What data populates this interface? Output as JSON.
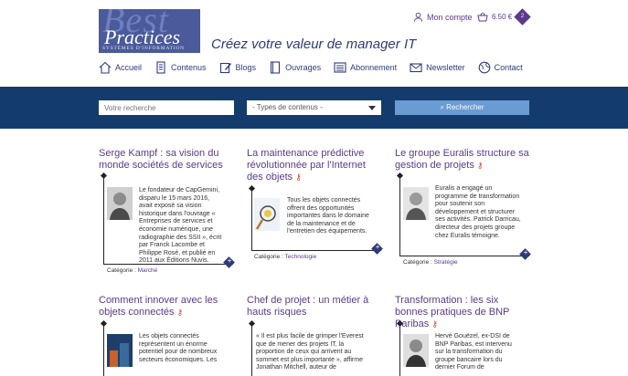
{
  "header": {
    "logo_big": "Best",
    "logo_practices": "Practices",
    "logo_sub": "SYSTÈMES D'INFORMATION",
    "tagline": "Créez votre valeur de manager IT",
    "account_label": "Mon compte",
    "cart_amount": "6.50 €",
    "cart_count": "2"
  },
  "nav": {
    "items": [
      {
        "label": "Accueil",
        "icon": "home-icon"
      },
      {
        "label": "Contenus",
        "icon": "document-icon"
      },
      {
        "label": "Blogs",
        "icon": "edit-icon"
      },
      {
        "label": "Ouvrages",
        "icon": "book-icon"
      },
      {
        "label": "Abonnement",
        "icon": "newspaper-icon"
      },
      {
        "label": "Newsletter",
        "icon": "envelope-icon"
      },
      {
        "label": "Contact",
        "icon": "globe-icon"
      }
    ]
  },
  "search": {
    "placeholder": "Votre recherche",
    "type_select": "- Types de contenus -",
    "button_label": "Rechercher"
  },
  "articles": [
    {
      "title": "Serge Kampf : sa vision du monde sociétés de services",
      "excerpt": "Le fondateur de CapGemini, disparu le 15 mars 2016, avait exposé sa vision historique dans l'ouvrage « Entreprises de services et économie numérique, une radiographie des SSII », écrit par Franck Lacombe et Philippe Rosé, et publié en 2011 aux Éditions Nuvis.",
      "category_label": "Catégorie :",
      "category": "Marché"
    },
    {
      "title": "La maintenance prédictive révolutionnée par l'Internet des objets",
      "excerpt": "Tous les objets connectés offrent des opportunités importantes dans le domaine de la maintenance et de l'entretien des équipements.",
      "category_label": "Catégorie :",
      "category": "Technologie"
    },
    {
      "title": "Le groupe Euralis structure sa gestion de projets",
      "excerpt": "Euralis a engagé un programme de transformation pour soutenir son développement et structurer ses activités. Patrick Darricau, directeur des projets groupe chez Euralis témoigne.",
      "category_label": "Catégorie :",
      "category": "Stratégie"
    },
    {
      "title": "Comment innover avec les objets connectés",
      "excerpt": "Les objets connectés représentent un énorme potentiel pour de nombreux secteurs économiques. Les"
    },
    {
      "title": "Chef de projet : un métier à hauts risques",
      "excerpt": "« Il est plus facile de grimper l'Everest que de mener des projets IT, la proportion de ceux qui arrivent au sommet est plus importante », affirme Jonathan Mitchell, auteur de"
    },
    {
      "title": "Transformation : les six bonnes pratiques de BNP Paribas",
      "excerpt": "Hervé Gouëzel, ex-DSI de BNP Paribas, est intervenu sur la transformation du groupe bancaire lors du dernier Forum de"
    }
  ],
  "colors": {
    "band": "#133c6c",
    "accent": "#5a3a8c",
    "nav": "#2d3b7a",
    "button": "#6a9bd2"
  }
}
